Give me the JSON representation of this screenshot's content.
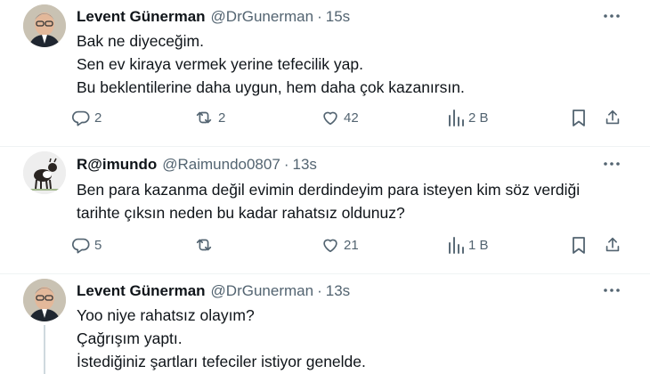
{
  "colors": {
    "text": "#0f1419",
    "muted": "#536471",
    "divider": "#eff3f4",
    "thread": "#cfd9de"
  },
  "tweets": [
    {
      "name": "Levent Günerman",
      "handle": "@DrGunerman",
      "time": "15s",
      "lines": [
        "Bak ne diyeceğim.",
        "Sen ev kiraya vermek yerine tefecilik yap.",
        "Bu beklentilerine daha uygun, hem daha çok kazanırsın."
      ],
      "replies": "2",
      "retweets": "2",
      "likes": "42",
      "views": "2 B"
    },
    {
      "name": "R@imundo",
      "handle": "@Raimundo0807",
      "time": "13s",
      "lines": [
        "Ben para kazanma değil evimin derdindeyim para isteyen kim söz verdiği",
        "tarihte çıksın neden bu kadar rahatsız oldunuz?"
      ],
      "replies": "5",
      "retweets": "",
      "likes": "21",
      "views": "1 B"
    },
    {
      "name": "Levent Günerman",
      "handle": "@DrGunerman",
      "time": "13s",
      "lines": [
        "Yoo niye rahatsız olayım?",
        "Çağrışım yaptı.",
        "İstediğiniz şartları tefeciler istiyor genelde."
      ]
    }
  ],
  "icons": {
    "more": "more-dots-icon",
    "reply": "reply-icon",
    "retweet": "retweet-icon",
    "like": "heart-icon",
    "views": "views-icon",
    "bookmark": "bookmark-icon",
    "share": "share-icon"
  }
}
